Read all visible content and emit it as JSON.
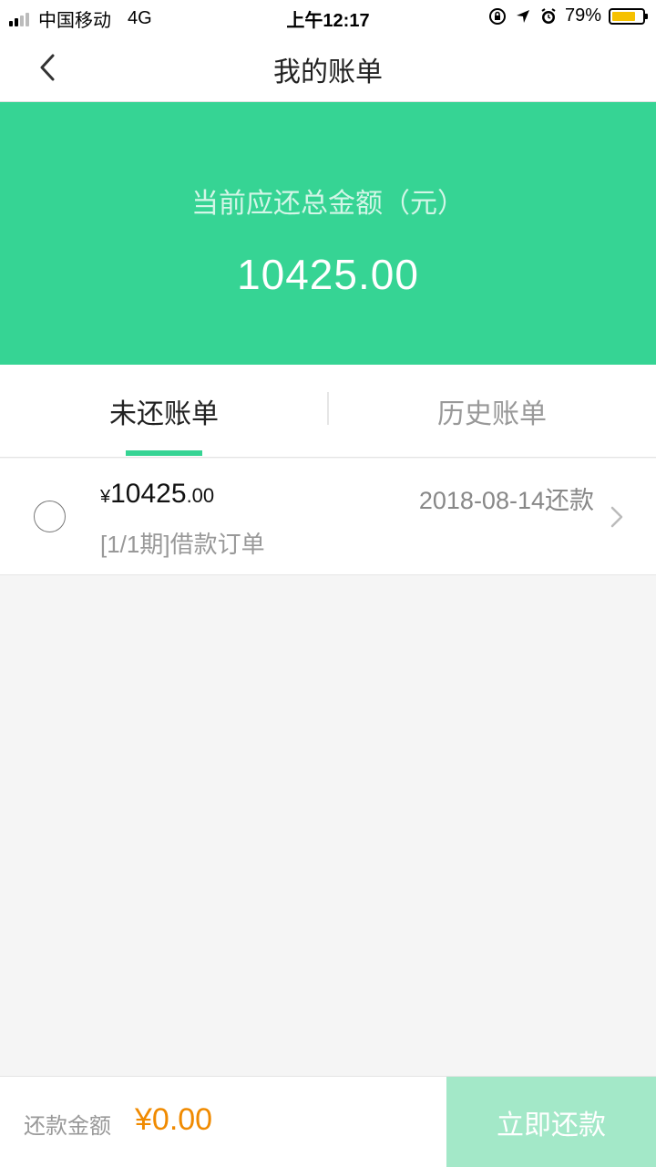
{
  "status_bar": {
    "carrier": "中国移动",
    "network": "4G",
    "time": "上午12:17",
    "battery_percent": "79%",
    "battery_level": 0.79,
    "signal_bars_filled": 2,
    "signal_bars_total": 4
  },
  "nav": {
    "title": "我的账单",
    "back_icon": "chevron-left-icon"
  },
  "summary": {
    "label": "当前应还总金额（元）",
    "amount": "10425.00"
  },
  "tabs": [
    {
      "label": "未还账单",
      "active": true
    },
    {
      "label": "历史账单",
      "active": false
    }
  ],
  "bills": [
    {
      "currency": "¥",
      "amount_int": "10425",
      "amount_dec": ".00",
      "due": "2018-08-14还款",
      "desc": "[1/1期]借款订单",
      "selected": false
    }
  ],
  "footer": {
    "label": "还款金额",
    "amount": "¥0.00",
    "pay_button": "立即还款"
  },
  "colors": {
    "brand": "#36d494",
    "button_disabled": "#a3e8c8",
    "amount": "#f08a00"
  }
}
